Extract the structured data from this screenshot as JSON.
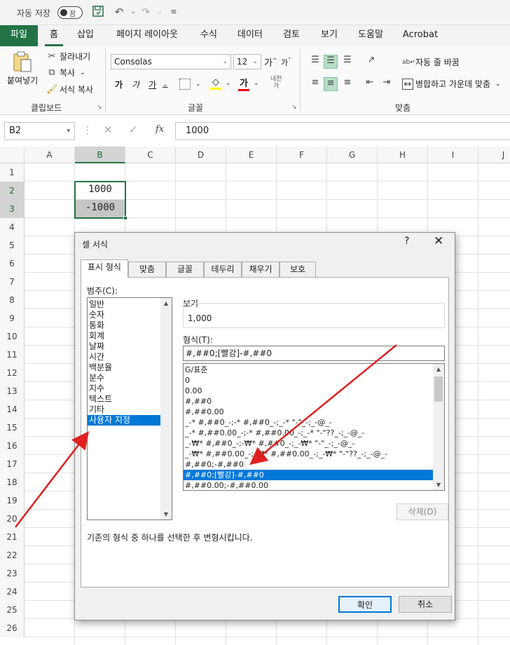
{
  "titlebar": {
    "autosave_label": "자동 저장",
    "toggle_state": "끔"
  },
  "ribbon_tabs": [
    "파일",
    "홈",
    "삽입",
    "페이지 레이아웃",
    "수식",
    "데이터",
    "검토",
    "보기",
    "도움말",
    "Acrobat"
  ],
  "clipboard": {
    "paste": "붙여넣기",
    "cut": "잘라내기",
    "copy": "복사",
    "format_painter": "서식 복사",
    "group": "클립보드"
  },
  "font": {
    "name": "Consolas",
    "size": "12",
    "bold": "가",
    "italic": "가",
    "underline": "가",
    "group": "글꼴"
  },
  "alignment": {
    "wrap": "자동 줄 바꿈",
    "merge": "병합하고 가운데 맞춤",
    "group": "맞춤"
  },
  "formula_bar": {
    "name_box": "B2",
    "fx": "fx",
    "value": "1000"
  },
  "grid": {
    "columns": [
      "A",
      "B",
      "C",
      "D",
      "E",
      "F",
      "G",
      "H",
      "I",
      "J"
    ],
    "rows": [
      "1",
      "2",
      "3",
      "4",
      "5",
      "6",
      "7",
      "8",
      "9",
      "10",
      "11",
      "12",
      "13",
      "14",
      "15",
      "16",
      "17",
      "18",
      "19",
      "20",
      "21",
      "22",
      "23",
      "24",
      "25",
      "26"
    ],
    "b2": "1000",
    "b3": "-1000"
  },
  "dialog": {
    "title": "셀 서식",
    "help": "?",
    "close": "✕",
    "tabs": [
      "표시 형식",
      "맞춤",
      "글꼴",
      "테두리",
      "채우기",
      "보호"
    ],
    "category_label": "범주(C):",
    "categories": [
      "일반",
      "숫자",
      "통화",
      "회계",
      "날짜",
      "시간",
      "백분율",
      "분수",
      "지수",
      "텍스트",
      "기타",
      "사용자 지정"
    ],
    "selected_category": "사용자 지정",
    "sample_label": "보기",
    "sample_value": "1,000",
    "type_label": "형식(T):",
    "type_value": "#,##0;[빨강]-#,##0",
    "formats": [
      "G/표준",
      "0",
      "0.00",
      "#,##0",
      "#,##0.00",
      "_-* #,##0_-;-* #,##0_-;_-* \"-\"_-;_-@_-",
      "_-* #,##0.00_-;-* #,##0.00_-;_-* \"-\"??_-;_-@_-",
      "_-₩* #,##0_-;-₩* #,##0_-;_-₩* \"-\"_-;_-@_-",
      "_-₩* #,##0.00_-;-₩* #,##0.00_-;_-₩* \"-\"??_-;_-@_-",
      "#,##0;-#,##0",
      "#,##0;[빨강]-#,##0",
      "#,##0.00;-#,##0.00"
    ],
    "selected_format": "#,##0;[빨강]-#,##0",
    "delete_button": "삭제(D)",
    "hint": "기존의 형식 중 하나를 선택한 후 변형시킵니다.",
    "ok_button": "확인",
    "cancel_button": "취소"
  },
  "colors": {
    "excel_green": "#217346",
    "selection_blue": "#0078d7",
    "arrow_red": "#e02020"
  }
}
